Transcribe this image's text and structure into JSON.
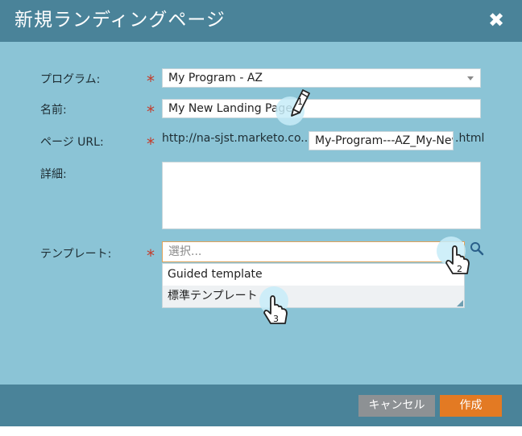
{
  "dialog": {
    "title": "新規ランディングページ",
    "close_glyph": "✖"
  },
  "form": {
    "required_mark": "*",
    "program": {
      "label": "プログラム:",
      "value": "My Program - AZ"
    },
    "name": {
      "label": "名前:",
      "value": "My New Landing Page"
    },
    "url": {
      "label": "ページ URL:",
      "prefix": "http://na-sjst.marketo.co...",
      "value": "My-Program---AZ_My-New",
      "suffix": ".html"
    },
    "description": {
      "label": "詳細:",
      "value": ""
    },
    "template": {
      "label": "テンプレート:",
      "placeholder": "選択...",
      "options": [
        "Guided template",
        "標準テンプレート"
      ]
    }
  },
  "footer": {
    "cancel_label": "キャンセル",
    "create_label": "作成"
  },
  "step_markers": [
    "1",
    "2",
    "3"
  ],
  "icons": {
    "close": "close-icon",
    "search": "search-icon",
    "pencil": "pencil-icon",
    "pointer": "hand-pointer-icon"
  },
  "colors": {
    "title_bar": "#4a8399",
    "panel": "#8bc4d6",
    "required": "#c43b2a",
    "create_button": "#e37a23",
    "cancel_button": "#8d9194"
  }
}
